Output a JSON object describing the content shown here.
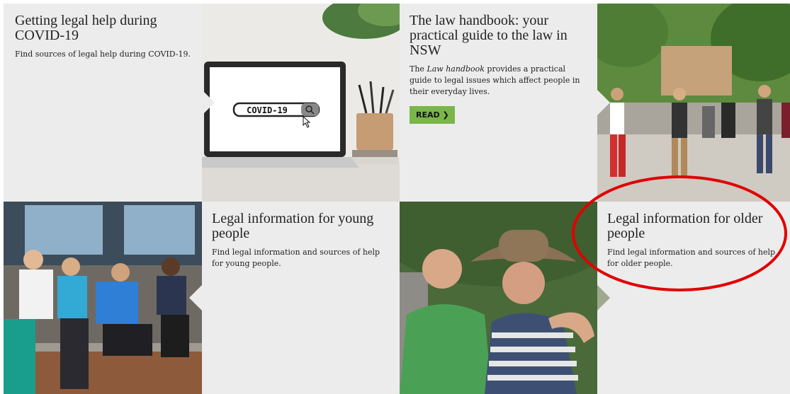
{
  "tiles": {
    "covid": {
      "title": "Getting legal help during COVID-19",
      "description": "Find sources of legal help during COVID-19."
    },
    "laptop_image": {
      "search_text": "COVID-19"
    },
    "handbook": {
      "title": "The law handbook: your practical guide to the law in NSW",
      "description_prefix": "The ",
      "description_em": "Law handbook",
      "description_suffix": " provides a practical guide to legal issues which affect people in their everyday lives.",
      "button_label": "READ",
      "button_icon": "chevron-right-icon",
      "button_color": "#7ab648"
    },
    "young": {
      "title": "Legal information for young people",
      "description": "Find legal information and sources of help for young people."
    },
    "older": {
      "title": "Legal information for older people",
      "description": "Find legal information and sources of help for older people."
    }
  },
  "annotation": {
    "shape": "ellipse",
    "color": "#e00000",
    "target": "Legal information for older people"
  },
  "colors": {
    "tile_background": "#ececec",
    "text": "#222222"
  }
}
